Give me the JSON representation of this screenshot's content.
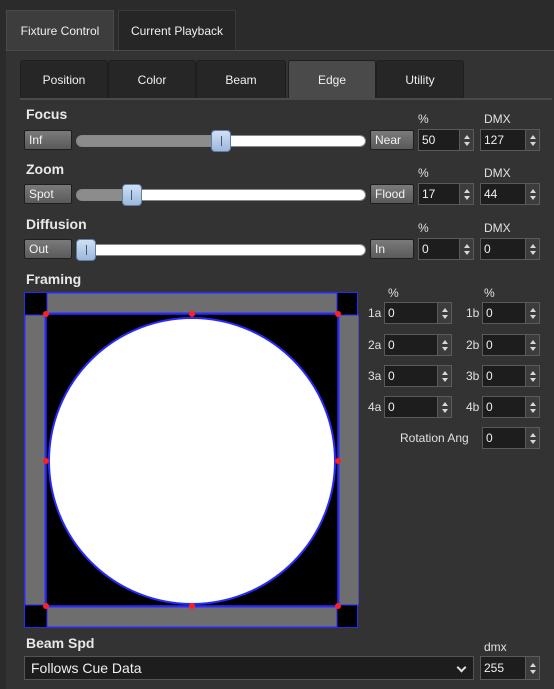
{
  "top_tabs": [
    {
      "label": "Fixture Control",
      "active": true
    },
    {
      "label": "Current Playback",
      "active": false
    }
  ],
  "sub_tabs": [
    {
      "label": "Position",
      "active": false
    },
    {
      "label": "Color",
      "active": false
    },
    {
      "label": "Beam",
      "active": false
    },
    {
      "label": "Edge",
      "active": true
    },
    {
      "label": "Utility",
      "active": false
    }
  ],
  "focus": {
    "title": "Focus",
    "min_label": "Inf",
    "max_label": "Near",
    "percent_header": "%",
    "dmx_header": "DMX",
    "percent": "50",
    "dmx": "127",
    "level": 0.5
  },
  "zoom": {
    "title": "Zoom",
    "min_label": "Spot",
    "max_label": "Flood",
    "percent_header": "%",
    "dmx_header": "DMX",
    "percent": "17",
    "dmx": "44",
    "level": 0.17
  },
  "diffusion": {
    "title": "Diffusion",
    "min_label": "Out",
    "max_label": "In",
    "percent_header": "%",
    "dmx_header": "DMX",
    "percent": "0",
    "dmx": "0",
    "level": 0.0
  },
  "framing": {
    "title": "Framing",
    "percent_header_a": "%",
    "percent_header_b": "%",
    "blades_a": [
      {
        "label": "1a",
        "value": "0"
      },
      {
        "label": "2a",
        "value": "0"
      },
      {
        "label": "3a",
        "value": "0"
      },
      {
        "label": "4a",
        "value": "0"
      }
    ],
    "blades_b": [
      {
        "label": "1b",
        "value": "0"
      },
      {
        "label": "2b",
        "value": "0"
      },
      {
        "label": "3b",
        "value": "0"
      },
      {
        "label": "4b",
        "value": "0"
      }
    ],
    "rotation_label": "Rotation Ang",
    "rotation_value": "0"
  },
  "beam_spd": {
    "title": "Beam Spd",
    "selected": "Follows Cue Data",
    "dmx_header": "dmx",
    "dmx_value": "255"
  },
  "colors": {
    "frame_outline": "#2a2aff",
    "handle_point": "#ff2020",
    "slider_handle": "#b8cfe9"
  }
}
